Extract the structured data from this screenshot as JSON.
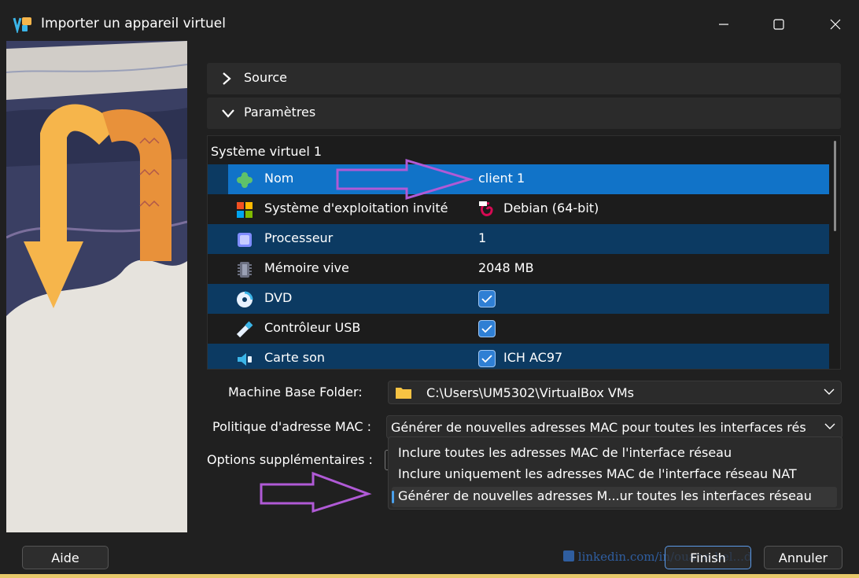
{
  "window": {
    "title": "Importer un appareil virtuel",
    "icons": {
      "app": "virtualbox-icon",
      "minimize": "minimize-icon",
      "maximize": "maximize-icon",
      "close": "close-icon"
    }
  },
  "sections": {
    "source": {
      "label": "Source",
      "icon": "chevron-right-icon"
    },
    "params": {
      "label": "Paramètres",
      "icon": "chevron-down-icon"
    }
  },
  "tree": {
    "header": "Système virtuel 1",
    "rows": [
      {
        "name": "Nom",
        "value": "client 1",
        "icon": "name-puzzle-icon"
      },
      {
        "name": "Système d'exploitation invité",
        "value": "Debian (64-bit)",
        "icon": "os-windows-icon",
        "value_icon": "debian-icon"
      },
      {
        "name": "Processeur",
        "value": "1",
        "icon": "cpu-icon"
      },
      {
        "name": "Mémoire vive",
        "value": "2048 MB",
        "icon": "ram-icon"
      },
      {
        "name": "DVD",
        "value": "",
        "checked": true,
        "icon": "dvd-icon"
      },
      {
        "name": "Contrôleur USB",
        "value": "",
        "checked": true,
        "icon": "usb-icon"
      },
      {
        "name": "Carte son",
        "value": "ICH AC97",
        "checked": true,
        "icon": "sound-icon"
      }
    ]
  },
  "form": {
    "base_folder_label": "Machine Base Folder:",
    "base_folder_value": "C:\\Users\\UM5302\\VirtualBox VMs",
    "mac_policy_label": "Politique d'adresse MAC :",
    "mac_policy_value": "Générer de nouvelles adresses MAC pour toutes les interfaces rés",
    "extra_options_label": "Options supplémentaires :"
  },
  "dropdown": {
    "options": [
      "Inclure toutes les adresses MAC de l'interface réseau",
      "Inclure uniquement les adresses MAC de l'interface réseau NAT",
      "Générer de nouvelles adresses M...ur toutes les interfaces réseau"
    ],
    "selected_index": 2
  },
  "buttons": {
    "help": "Aide",
    "finish": "Finish",
    "cancel": "Annuler"
  },
  "watermark": "linkedin.com/in/ouane-bel...d",
  "colors": {
    "accent": "#1173c8",
    "alt_row": "#0c3a62",
    "annotation": "#b05ad6",
    "art_arrow": "#f6b54b"
  }
}
